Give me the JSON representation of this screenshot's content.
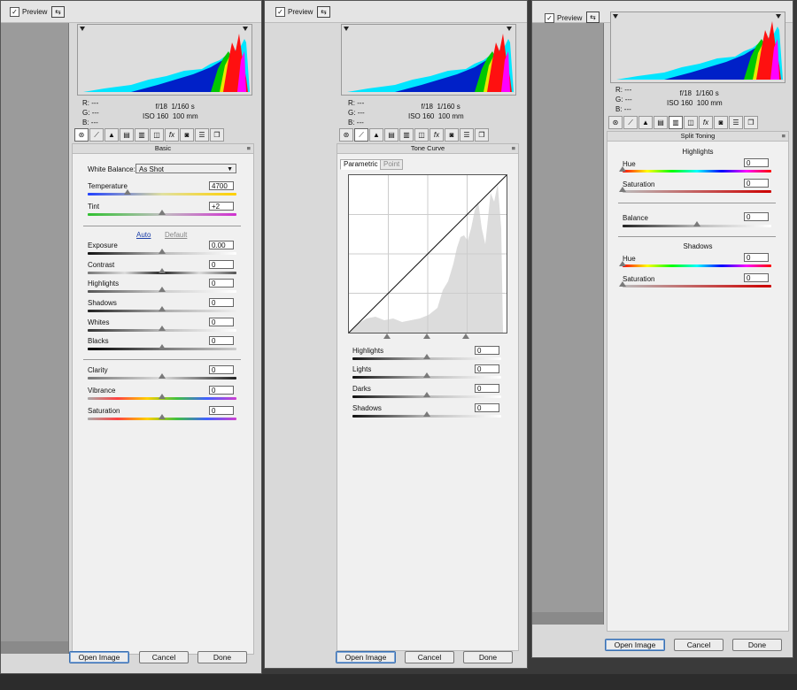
{
  "preview_label": "Preview",
  "info": {
    "r": "R:",
    "g": "G:",
    "b": "B:",
    "dash": "---",
    "aperture": "f/18",
    "shutter": "1/160 s",
    "iso": "ISO 160",
    "focal": "100 mm"
  },
  "buttons": {
    "open": "Open Image",
    "cancel": "Cancel",
    "done": "Done"
  },
  "basic": {
    "title": "Basic",
    "wb_label": "White Balance:",
    "wb_value": "As Shot",
    "temperature": {
      "label": "Temperature",
      "value": "4700"
    },
    "tint": {
      "label": "Tint",
      "value": "+2"
    },
    "auto": "Auto",
    "default": "Default",
    "exposure": {
      "label": "Exposure",
      "value": "0.00"
    },
    "contrast": {
      "label": "Contrast",
      "value": "0"
    },
    "highlights": {
      "label": "Highlights",
      "value": "0"
    },
    "shadows": {
      "label": "Shadows",
      "value": "0"
    },
    "whites": {
      "label": "Whites",
      "value": "0"
    },
    "blacks": {
      "label": "Blacks",
      "value": "0"
    },
    "clarity": {
      "label": "Clarity",
      "value": "0"
    },
    "vibrance": {
      "label": "Vibrance",
      "value": "0"
    },
    "saturation": {
      "label": "Saturation",
      "value": "0"
    }
  },
  "tone": {
    "title": "Tone Curve",
    "tab_parametric": "Parametric",
    "tab_point": "Point",
    "highlights": {
      "label": "Highlights",
      "value": "0"
    },
    "lights": {
      "label": "Lights",
      "value": "0"
    },
    "darks": {
      "label": "Darks",
      "value": "0"
    },
    "shadows": {
      "label": "Shadows",
      "value": "0"
    }
  },
  "split": {
    "title": "Split Toning",
    "highlights_header": "Highlights",
    "h_hue": {
      "label": "Hue",
      "value": "0"
    },
    "h_sat": {
      "label": "Saturation",
      "value": "0"
    },
    "balance": {
      "label": "Balance",
      "value": "0"
    },
    "shadows_header": "Shadows",
    "s_hue": {
      "label": "Hue",
      "value": "0"
    },
    "s_sat": {
      "label": "Saturation",
      "value": "0"
    }
  },
  "tab_icons": [
    "aperture-icon",
    "curve-icon",
    "detail-icon",
    "hsl-icon",
    "split-toning-icon",
    "lens-icon",
    "fx-icon",
    "camera-calibration-icon",
    "presets-icon",
    "snapshots-icon"
  ],
  "colors": {
    "accent": "#3a6fb0",
    "link": "#1c3fa8"
  }
}
